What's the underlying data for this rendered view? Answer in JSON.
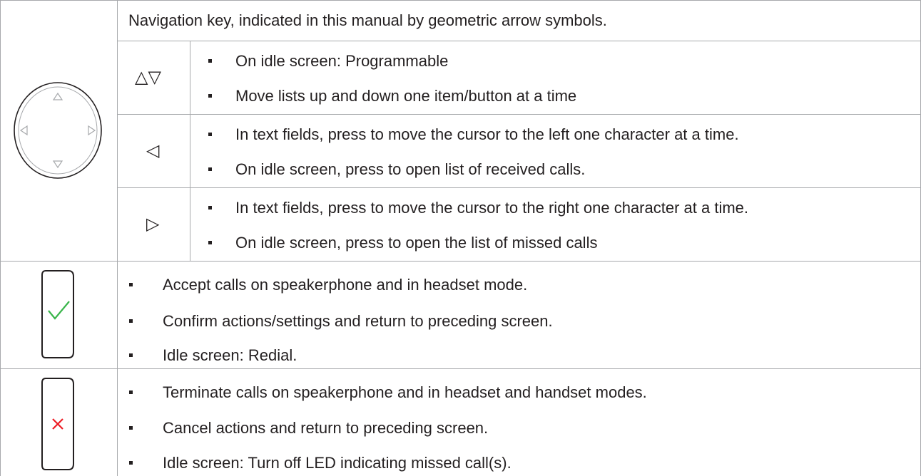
{
  "rows": [
    {
      "icon": "navigation-key-icon",
      "header": "Navigation key, indicated in this manual by geometric arrow symbols.",
      "subrows": [
        {
          "symbol": "△▽",
          "symbol_name": "up-down-arrows-icon",
          "items": [
            "On idle screen:  Programmable",
            "Move lists up and down one item/button at a time"
          ]
        },
        {
          "symbol": "◁",
          "symbol_name": "left-arrow-icon",
          "items": [
            "In text fields, press to move the cursor to the left one character at a time.",
            "On idle screen, press to open list of received calls."
          ]
        },
        {
          "symbol": "▷",
          "symbol_name": "right-arrow-icon",
          "items": [
            "In text fields, press to move the cursor to the right one character at a time.",
            "On idle screen, press to open the list of missed calls"
          ]
        }
      ]
    },
    {
      "icon": "accept-key-icon",
      "icon_color": "#39b54a",
      "items": [
        "Accept calls on speakerphone and in headset mode.",
        "Confirm actions/settings and return to preceding screen.",
        "Idle screen:  Redial."
      ]
    },
    {
      "icon": "cancel-key-icon",
      "icon_color": "#ed1c24",
      "items": [
        "Terminate calls on speakerphone and in headset and handset modes.",
        "Cancel actions and return to preceding screen.",
        "Idle screen:  Turn off LED indicating missed call(s)."
      ]
    }
  ]
}
